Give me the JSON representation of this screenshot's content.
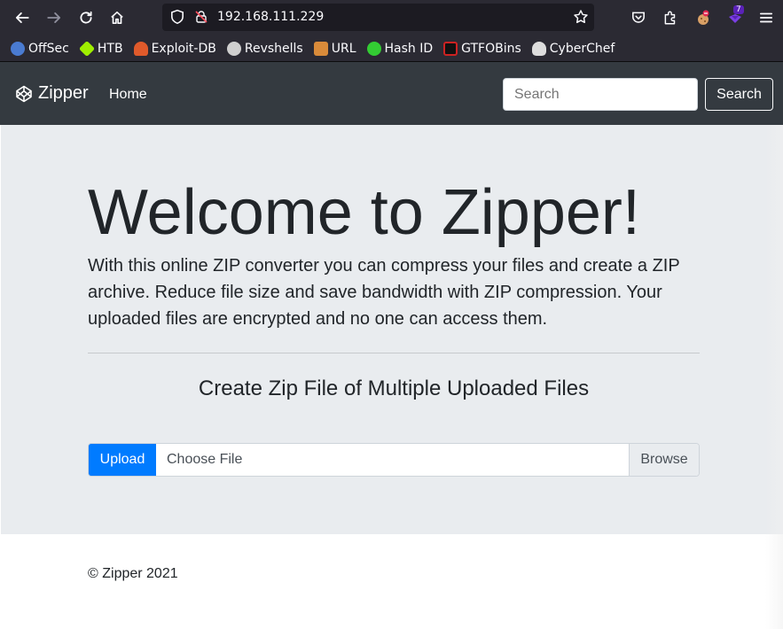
{
  "browser": {
    "url": "192.168.111.229",
    "extension_badge": "7",
    "bookmarks": [
      {
        "label": "OffSec",
        "icon": "offsec-icon",
        "color": "#4a7bd1"
      },
      {
        "label": "HTB",
        "icon": "htb-cube-icon",
        "color": "#9fef00"
      },
      {
        "label": "Exploit-DB",
        "icon": "exploit-db-icon",
        "color": "#e05a2b"
      },
      {
        "label": "Revshells",
        "icon": "skull-icon",
        "color": "#cfcfcf"
      },
      {
        "label": "URL",
        "icon": "url-icon",
        "color": "#d98b3a"
      },
      {
        "label": "Hash ID",
        "icon": "hashid-icon",
        "color": "#33cc33"
      },
      {
        "label": "GTFOBins",
        "icon": "gtfobins-icon",
        "color": "#cc2222"
      },
      {
        "label": "CyberChef",
        "icon": "cyberchef-icon",
        "color": "#dddddd"
      }
    ]
  },
  "navbar": {
    "brand": "Zipper",
    "home": "Home",
    "search_placeholder": "Search",
    "search_button": "Search"
  },
  "hero": {
    "title": "Welcome to Zipper!",
    "lead": "With this online ZIP converter you can compress your files and create a ZIP archive. Reduce file size and save bandwidth with ZIP compression. Your uploaded files are encrypted and no one can access them.",
    "subtitle": "Create Zip File of Multiple Uploaded Files",
    "upload_button": "Upload",
    "file_placeholder": "Choose File",
    "browse_button": "Browse"
  },
  "footer": {
    "copyright": "© Zipper 2021"
  },
  "colors": {
    "navbar_bg": "#343a40",
    "jumbotron_bg": "#e9ecef",
    "primary": "#007bff",
    "browser_chrome": "#2b2a33"
  }
}
